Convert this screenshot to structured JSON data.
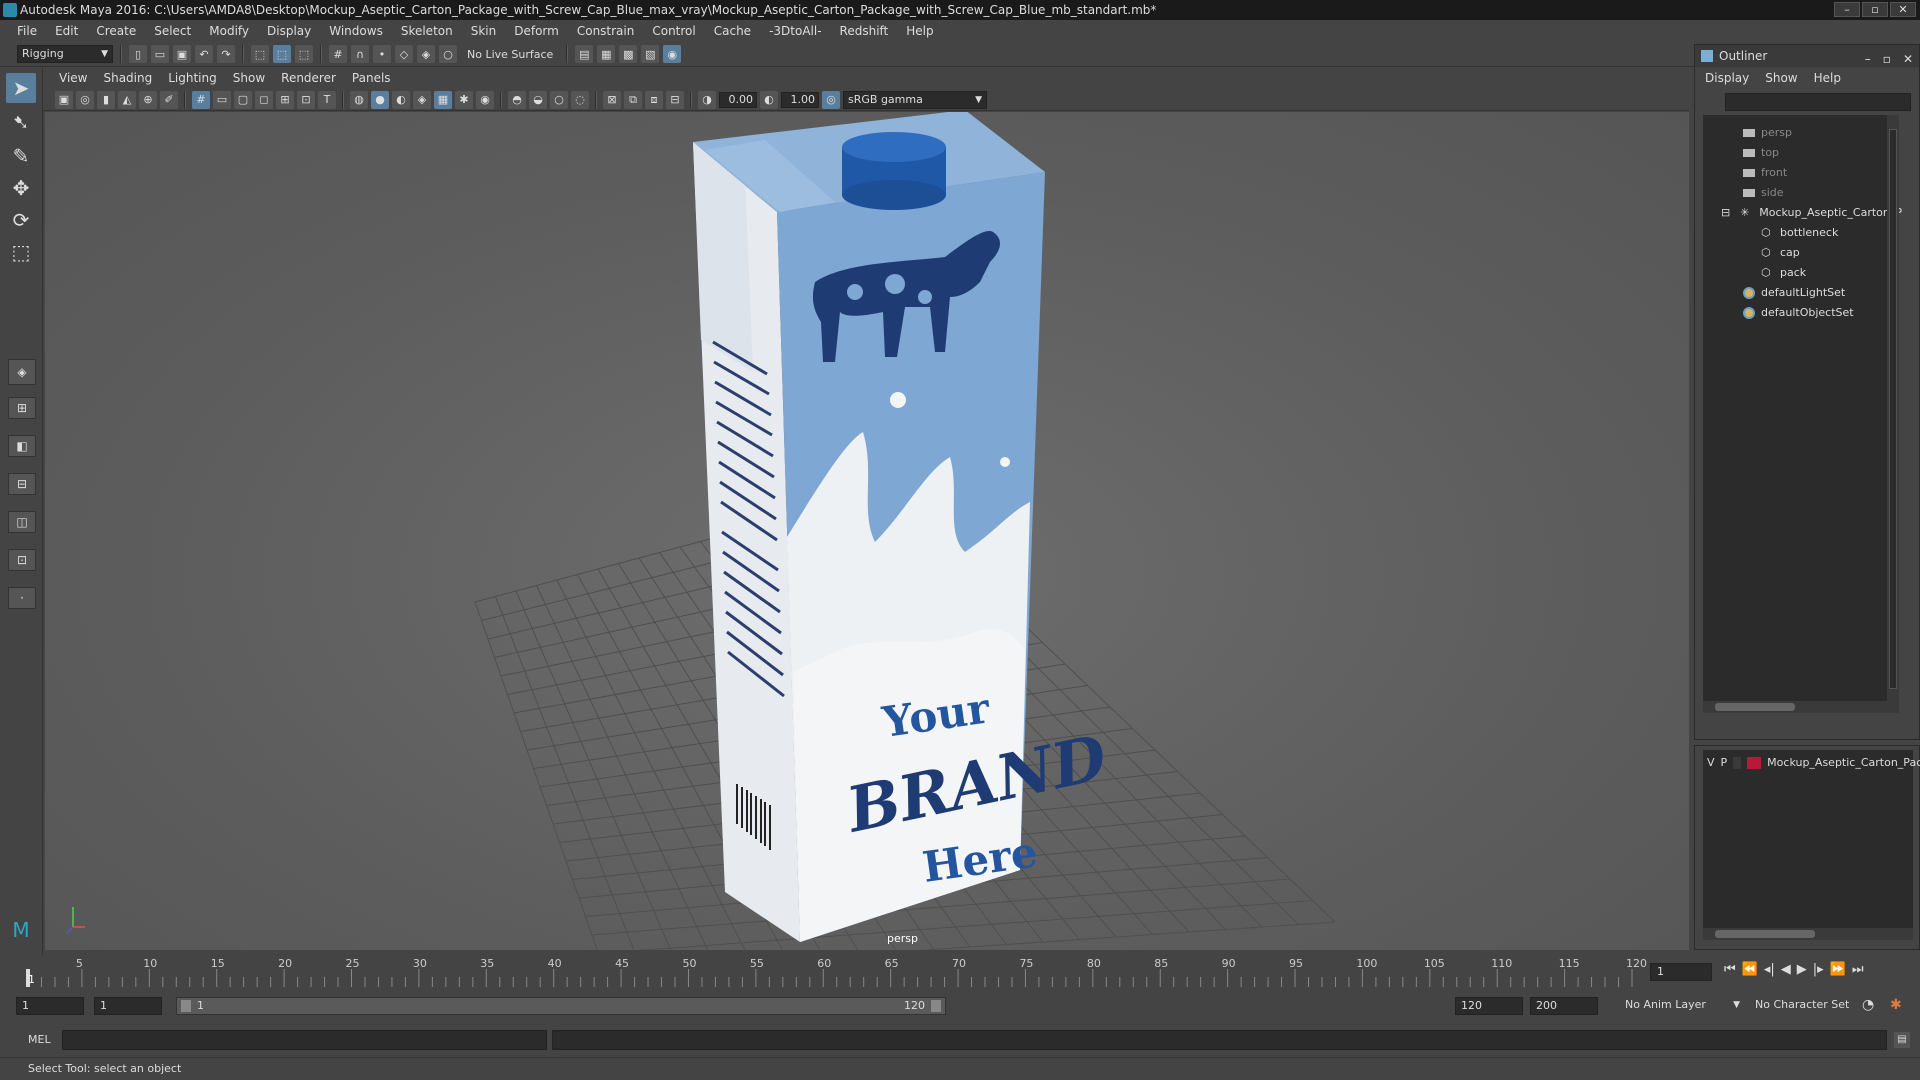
{
  "window": {
    "title": "Autodesk Maya 2016: C:\\Users\\AMDA8\\Desktop\\Mockup_Aseptic_Carton_Package_with_Screw_Cap_Blue_max_vray\\Mockup_Aseptic_Carton_Package_with_Screw_Cap_Blue_mb_standart.mb*",
    "controls": [
      "–",
      "▫",
      "✕"
    ]
  },
  "menubar": [
    "File",
    "Edit",
    "Create",
    "Select",
    "Modify",
    "Display",
    "Windows",
    "Skeleton",
    "Skin",
    "Deform",
    "Constrain",
    "Control",
    "Cache",
    "-3DtoAll-",
    "Redshift",
    "Help"
  ],
  "shelf": {
    "mode": "Rigging",
    "live_surface": "No Live Surface"
  },
  "panel": {
    "menus": [
      "View",
      "Shading",
      "Lighting",
      "Show",
      "Renderer",
      "Panels"
    ],
    "exposure": "0.00",
    "gamma": "1.00",
    "color_space": "sRGB gamma",
    "camera_label": "persp"
  },
  "artwork": {
    "brand_line1": "Your",
    "brand_line2": "BRAND",
    "brand_line3": "Here"
  },
  "outliner": {
    "title": "Outliner",
    "menus": [
      "Display",
      "Show",
      "Help"
    ],
    "items": [
      {
        "label": "persp",
        "type": "camera"
      },
      {
        "label": "top",
        "type": "camera"
      },
      {
        "label": "front",
        "type": "camera"
      },
      {
        "label": "side",
        "type": "camera"
      },
      {
        "label": "Mockup_Aseptic_Carton_P",
        "type": "group"
      },
      {
        "label": "bottleneck",
        "type": "mesh"
      },
      {
        "label": "cap",
        "type": "mesh"
      },
      {
        "label": "pack",
        "type": "mesh"
      },
      {
        "label": "defaultLightSet",
        "type": "set"
      },
      {
        "label": "defaultObjectSet",
        "type": "set"
      }
    ]
  },
  "layers": {
    "v": "V",
    "p": "P",
    "name": "Mockup_Aseptic_Carton_Pac",
    "color": "#b8183a"
  },
  "timeline": {
    "ticks": [
      "5",
      "10",
      "15",
      "20",
      "25",
      "30",
      "35",
      "40",
      "45",
      "50",
      "55",
      "60",
      "65",
      "70",
      "75",
      "80",
      "85",
      "90",
      "95",
      "100",
      "105",
      "110",
      "115",
      "120"
    ],
    "current_frame_marker": "1",
    "current_frame": "1"
  },
  "range": {
    "start": "1",
    "playback_start": "1",
    "slider_start": "1",
    "slider_end": "120",
    "playback_end": "120",
    "end": "200",
    "anim_layer": "No Anim Layer",
    "character_set": "No Character Set"
  },
  "cmdline": {
    "label": "MEL"
  },
  "status": {
    "help": "Select Tool: select an object"
  }
}
